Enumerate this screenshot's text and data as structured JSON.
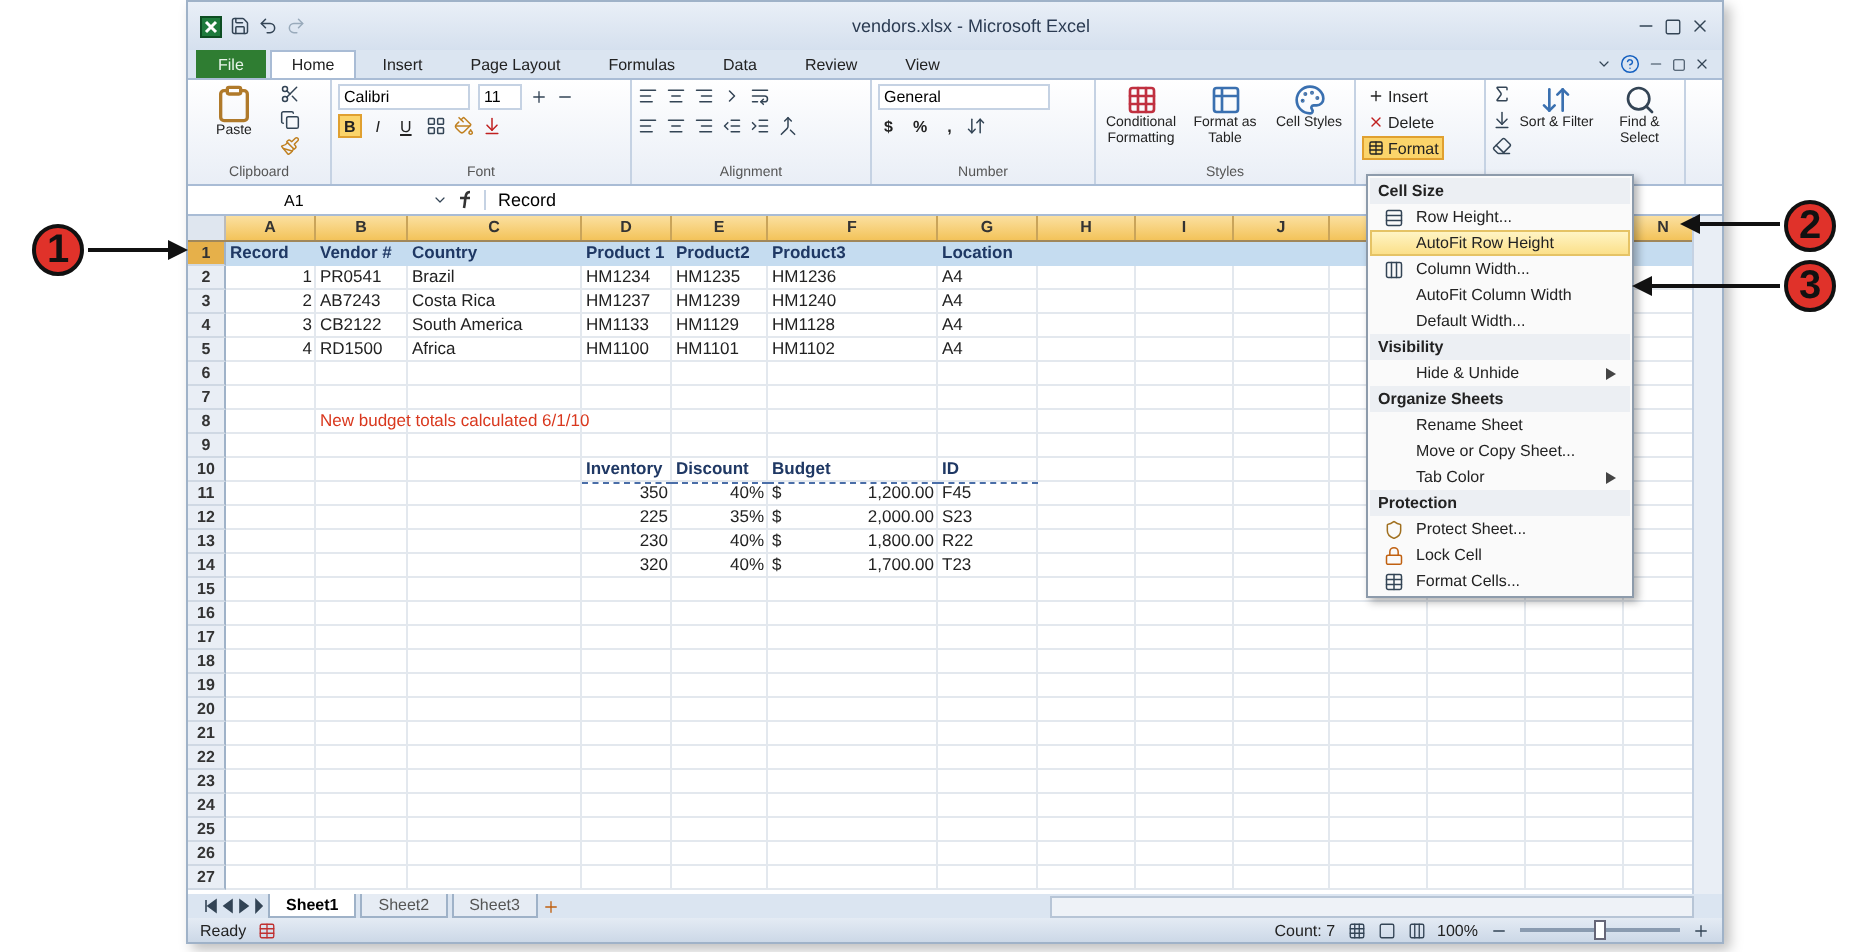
{
  "window": {
    "title": "vendors.xlsx - Microsoft Excel"
  },
  "ribbon_tabs": [
    {
      "label": "File",
      "kind": "file",
      "selected": false
    },
    {
      "label": "Home",
      "kind": "tab",
      "selected": true
    },
    {
      "label": "Insert",
      "kind": "tab",
      "selected": false
    },
    {
      "label": "Page Layout",
      "kind": "tab",
      "selected": false
    },
    {
      "label": "Formulas",
      "kind": "tab",
      "selected": false
    },
    {
      "label": "Data",
      "kind": "tab",
      "selected": false
    },
    {
      "label": "Review",
      "kind": "tab",
      "selected": false
    },
    {
      "label": "View",
      "kind": "tab",
      "selected": false
    }
  ],
  "ribbon": {
    "clipboard": {
      "paste": "Paste",
      "label": "Clipboard"
    },
    "font": {
      "name": "Calibri",
      "size": "11",
      "bold": "B",
      "italic": "I",
      "underline": "U",
      "label": "Font"
    },
    "alignment": {
      "label": "Alignment"
    },
    "number": {
      "format": "General",
      "currency": "$",
      "percent": "%",
      "comma": ",",
      "label": "Number"
    },
    "styles": {
      "buttons": [
        "Conditional Formatting",
        "Format as Table",
        "Cell Styles"
      ],
      "label": "Styles"
    },
    "cells": [
      {
        "label": "Insert",
        "selected": false
      },
      {
        "label": "Delete",
        "selected": false
      },
      {
        "label": "Format",
        "selected": true
      }
    ],
    "editing": [
      "Sort & Filter",
      "Find & Select"
    ]
  },
  "formula_bar": {
    "name_box": "A1",
    "formula": "Record"
  },
  "columns": [
    {
      "letter": "A",
      "selected": true
    },
    {
      "letter": "B",
      "selected": true
    },
    {
      "letter": "C",
      "selected": true
    },
    {
      "letter": "D",
      "selected": true
    },
    {
      "letter": "E",
      "selected": true
    },
    {
      "letter": "F",
      "selected": true
    },
    {
      "letter": "G",
      "selected": true
    },
    {
      "letter": "H",
      "selected": true
    },
    {
      "letter": "I",
      "selected": true
    },
    {
      "letter": "J",
      "selected": true
    }
  ],
  "far_column": {
    "letter": "N",
    "selected": true
  },
  "rows": [
    {
      "number": "1",
      "selected": true
    },
    {
      "number": "2",
      "selected": false
    },
    {
      "number": "3",
      "selected": false
    },
    {
      "number": "4",
      "selected": false
    },
    {
      "number": "5",
      "selected": false
    },
    {
      "number": "6",
      "selected": false
    },
    {
      "number": "7",
      "selected": false
    },
    {
      "number": "8",
      "selected": false
    },
    {
      "number": "9",
      "selected": false
    },
    {
      "number": "10",
      "selected": false
    },
    {
      "number": "11",
      "selected": false
    },
    {
      "number": "12",
      "selected": false
    },
    {
      "number": "13",
      "selected": false
    },
    {
      "number": "14",
      "selected": false
    },
    {
      "number": "15",
      "selected": false
    },
    {
      "number": "16",
      "selected": false
    },
    {
      "number": "17",
      "selected": false
    },
    {
      "number": "18",
      "selected": false
    },
    {
      "number": "19",
      "selected": false
    },
    {
      "number": "20",
      "selected": false
    },
    {
      "number": "21",
      "selected": false
    },
    {
      "number": "22",
      "selected": false
    },
    {
      "number": "23",
      "selected": false
    },
    {
      "number": "24",
      "selected": false
    },
    {
      "number": "25",
      "selected": false
    },
    {
      "number": "26",
      "selected": false
    },
    {
      "number": "27",
      "selected": false
    }
  ],
  "vendor_table": {
    "headers": [
      "Record",
      "Vendor #",
      "Country",
      "Product 1",
      "Product2",
      "Product3",
      "Location"
    ],
    "rows": [
      [
        "1",
        "PR0541",
        "Brazil",
        "HM1234",
        "HM1235",
        "HM1236",
        "A4"
      ],
      [
        "2",
        "AB7243",
        "Costa Rica",
        "HM1237",
        "HM1239",
        "HM1240",
        "A4"
      ],
      [
        "3",
        "CB2122",
        "South America",
        "HM1133",
        "HM1129",
        "HM1128",
        "A4"
      ],
      [
        "4",
        "RD1500",
        "Africa",
        "HM1100",
        "HM1101",
        "HM1102",
        "A4"
      ]
    ]
  },
  "note": "New budget totals calculated 6/1/10",
  "budget_table": {
    "headers": [
      "Inventory",
      "Discount",
      "Budget",
      "ID"
    ],
    "rows": [
      {
        "inventory": "350",
        "discount": "40%",
        "currency": "$",
        "budget": "1,200.00",
        "id": "F45"
      },
      {
        "inventory": "225",
        "discount": "35%",
        "currency": "$",
        "budget": "2,000.00",
        "id": "S23"
      },
      {
        "inventory": "230",
        "discount": "40%",
        "currency": "$",
        "budget": "1,800.00",
        "id": "R22"
      },
      {
        "inventory": "320",
        "discount": "40%",
        "currency": "$",
        "budget": "1,700.00",
        "id": "T23"
      }
    ]
  },
  "format_menu": {
    "sections": [
      {
        "heading": "Cell Size",
        "items": [
          {
            "label": "Row Height...",
            "kind": "row-height",
            "submenu": false,
            "selected": false
          },
          {
            "label": "AutoFit Row Height",
            "kind": "plain",
            "submenu": false,
            "selected": true
          },
          {
            "label": "Column Width...",
            "kind": "column-width",
            "submenu": false,
            "selected": false
          },
          {
            "label": "AutoFit Column Width",
            "kind": "plain",
            "submenu": false,
            "selected": false
          },
          {
            "label": "Default Width...",
            "kind": "plain",
            "submenu": false,
            "selected": false
          }
        ]
      },
      {
        "heading": "Visibility",
        "items": [
          {
            "label": "Hide & Unhide",
            "kind": "plain",
            "submenu": true,
            "selected": false
          }
        ]
      },
      {
        "heading": "Organize Sheets",
        "items": [
          {
            "label": "Rename Sheet",
            "kind": "plain",
            "submenu": false,
            "selected": false
          },
          {
            "label": "Move or Copy Sheet...",
            "kind": "plain",
            "submenu": false,
            "selected": false
          },
          {
            "label": "Tab Color",
            "kind": "plain",
            "submenu": true,
            "selected": false
          }
        ]
      },
      {
        "heading": "Protection",
        "items": [
          {
            "label": "Protect Sheet...",
            "kind": "protect",
            "submenu": false,
            "selected": false
          },
          {
            "label": "Lock Cell",
            "kind": "lock",
            "submenu": false,
            "selected": false
          },
          {
            "label": "Format Cells...",
            "kind": "format-cells",
            "submenu": false,
            "selected": false
          }
        ]
      }
    ]
  },
  "sheet_tabs": [
    {
      "label": "Sheet1",
      "selected": true
    },
    {
      "label": "Sheet2",
      "selected": false
    },
    {
      "label": "Sheet3",
      "selected": false
    }
  ],
  "status_bar": {
    "mode": "Ready",
    "count": "Count: 7",
    "zoom": {
      "label": "100%",
      "level": 0.5
    }
  },
  "callouts": [
    {
      "label": "1"
    },
    {
      "label": "2"
    },
    {
      "label": "3"
    }
  ]
}
